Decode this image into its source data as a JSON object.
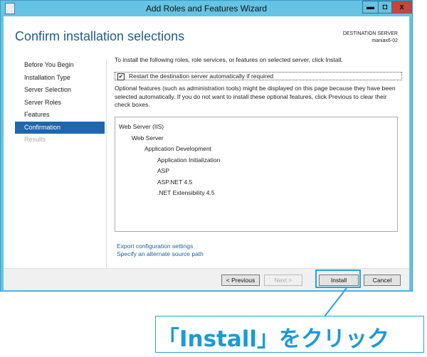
{
  "window": {
    "title": "Add Roles and Features Wizard",
    "minimize": "▬",
    "maximize": "◘",
    "close": "x"
  },
  "header": {
    "title": "Confirm installation selections",
    "dest_label": "DESTINATION SERVER",
    "dest_server": "maniax6-02"
  },
  "nav": {
    "items": [
      {
        "label": "Before You Begin"
      },
      {
        "label": "Installation Type"
      },
      {
        "label": "Server Selection"
      },
      {
        "label": "Server Roles"
      },
      {
        "label": "Features"
      },
      {
        "label": "Confirmation"
      },
      {
        "label": "Results"
      }
    ]
  },
  "main": {
    "intro": "To install the following roles, role services, or features on selected server, click Install.",
    "restart_label": "Restart the destination server automatically if required",
    "restart_checked": "✔",
    "optional_text": "Optional features (such as administration tools) might be displayed on this page because they have been selected automatically. If you do not want to install these optional features, click Previous to clear their check boxes.",
    "features": [
      "Web Server (IIS)",
      "Web Server",
      "Application Development",
      "Application Initialization",
      "ASP",
      "ASP.NET 4.5",
      ".NET Extensibility 4.5"
    ],
    "export_link": "Export configuration settings",
    "alt_source_link": "Specify an alternate source path"
  },
  "footer": {
    "previous": "< Previous",
    "next": "Next >",
    "install": "Install",
    "cancel": "Cancel"
  },
  "callout": {
    "text": "「Install」をクリック",
    "color": "#1b9ad6"
  }
}
